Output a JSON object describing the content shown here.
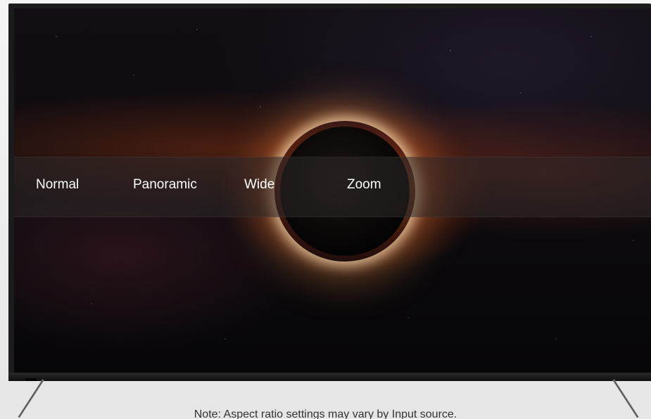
{
  "menu": {
    "items": [
      {
        "label": "Normal"
      },
      {
        "label": "Panoramic"
      },
      {
        "label": "Wide"
      },
      {
        "label": "Zoom"
      }
    ]
  },
  "footer": {
    "note": "Note: Aspect ratio settings may vary by Input source."
  },
  "colors": {
    "menu_text": "#ffffff",
    "menu_band": "#2d2828",
    "tv_bezel": "#1b1b1b"
  }
}
